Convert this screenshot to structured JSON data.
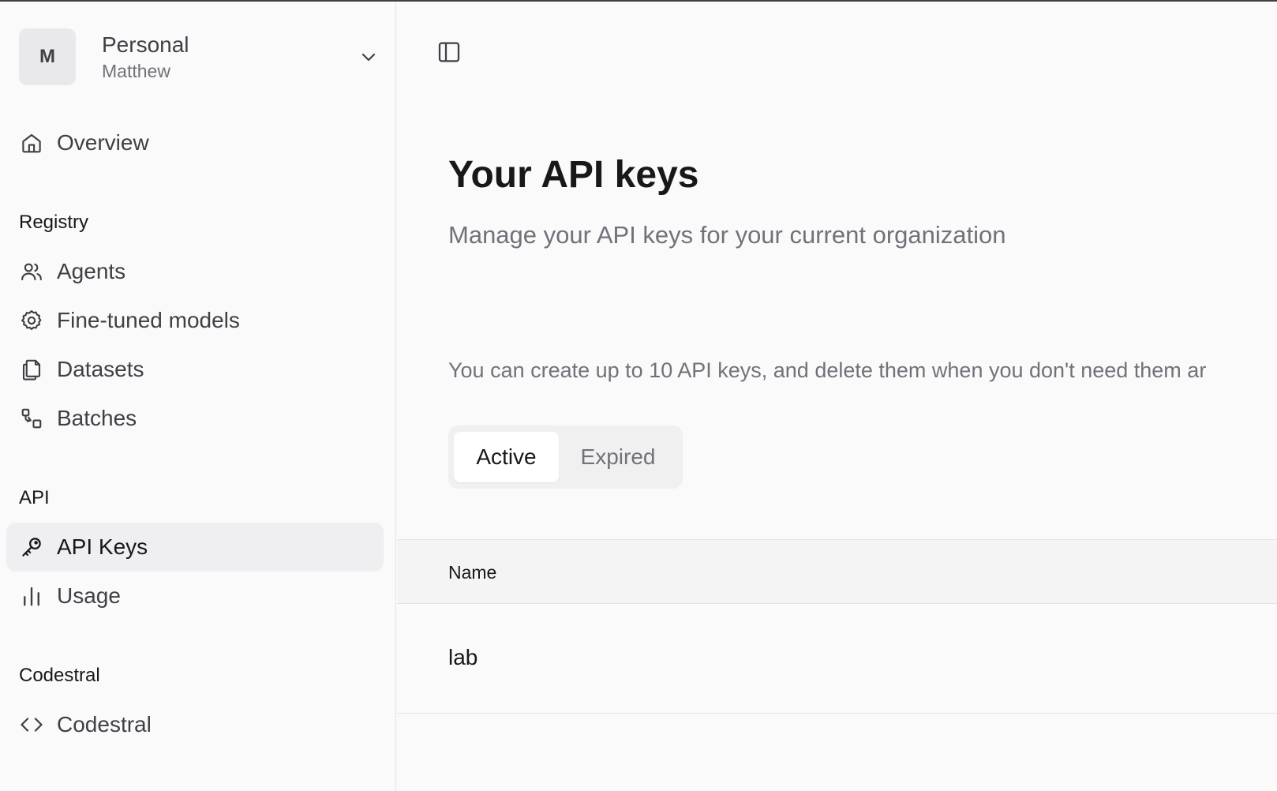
{
  "org": {
    "avatar": "M",
    "name": "Personal",
    "user": "Matthew"
  },
  "nav": {
    "overview": "Overview",
    "registry_title": "Registry",
    "agents": "Agents",
    "fine_tuned": "Fine-tuned models",
    "datasets": "Datasets",
    "batches": "Batches",
    "api_title": "API",
    "api_keys": "API Keys",
    "usage": "Usage",
    "codestral_title": "Codestral",
    "codestral": "Codestral",
    "active_item": "API Keys"
  },
  "main": {
    "title": "Your API keys",
    "subtitle": "Manage your API keys for your current organization",
    "info": "You can create up to 10 API keys, and delete them when you don't need them ar",
    "tabs": [
      {
        "label": "Active",
        "selected": true
      },
      {
        "label": "Expired",
        "selected": false
      }
    ],
    "table": {
      "columns": [
        "Name"
      ],
      "rows": [
        [
          "lab"
        ]
      ]
    }
  },
  "icons": {
    "org_chevron": "chevron-down-icon",
    "overview": "home-icon",
    "agents": "users-icon",
    "fine_tuned": "gear-icon",
    "datasets": "files-icon",
    "batches": "batch-icon",
    "api_keys": "key-icon",
    "usage": "bar-chart-icon",
    "codestral": "code-icon",
    "sidebar_toggle": "sidebar-toggle-icon"
  }
}
